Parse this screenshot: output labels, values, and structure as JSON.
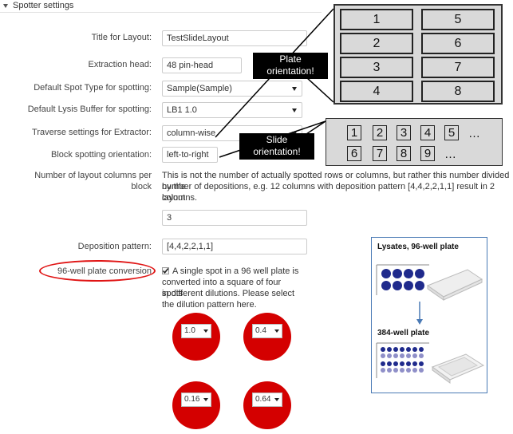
{
  "section": {
    "title": "Spotter settings"
  },
  "form": {
    "title_label": "Title for Layout:",
    "title_value": "TestSlideLayout",
    "extraction_label": "Extraction head:",
    "extraction_value": "48 pin-head",
    "spot_type_label": "Default Spot Type for spotting:",
    "spot_type_value": "Sample(Sample)",
    "lysis_label": "Default Lysis Buffer for spotting:",
    "lysis_value": "LB1 1.0",
    "traverse_label": "Traverse settings for Extractor:",
    "traverse_value": "column-wise",
    "block_label": "Block spotting orientation:",
    "block_value": "left-to-right",
    "columns_label_1": "Number of layout columns per",
    "columns_label_2": "block",
    "columns_desc_1": "This is not the number of actually spotted rows or columns, but rather this number divided by the",
    "columns_desc_2": "number of depositions, e.g. 12 columns with deposition pattern [4,4,2,2,1,1] result in 2 layout",
    "columns_desc_3": "columns.",
    "columns_value": "3",
    "deposition_label": "Deposition pattern:",
    "deposition_value": "[4,4,2,2,1,1]",
    "conversion_label": "96-well plate conversion",
    "conversion_desc_1": "A single spot in a 96 well plate is",
    "conversion_desc_2": "converted into a square of four spots",
    "conversion_desc_3": "in different dilutions. Please select",
    "conversion_desc_4": "the dilution pattern here."
  },
  "dilutions": [
    "1.0",
    "0.4",
    "0.16",
    "0.64"
  ],
  "callouts": {
    "plate_1": "Plate",
    "plate_2": "orientation!",
    "slide_1": "Slide",
    "slide_2": "orientation!"
  },
  "plate_grid": [
    "1",
    "5",
    "2",
    "6",
    "3",
    "7",
    "4",
    "8"
  ],
  "slide_grid": {
    "row1": [
      "1",
      "2",
      "3",
      "4",
      "5"
    ],
    "row2": [
      "6",
      "7",
      "8",
      "9"
    ],
    "ellipsis": "…"
  },
  "lysates": {
    "title": "Lysates, 96-well plate",
    "subtitle": "384-well plate"
  },
  "colors": {
    "accent_red": "#d40000",
    "callout_bg": "#000000",
    "panel_border": "#4a7ab5",
    "well_blue": "#1f2a8c"
  }
}
